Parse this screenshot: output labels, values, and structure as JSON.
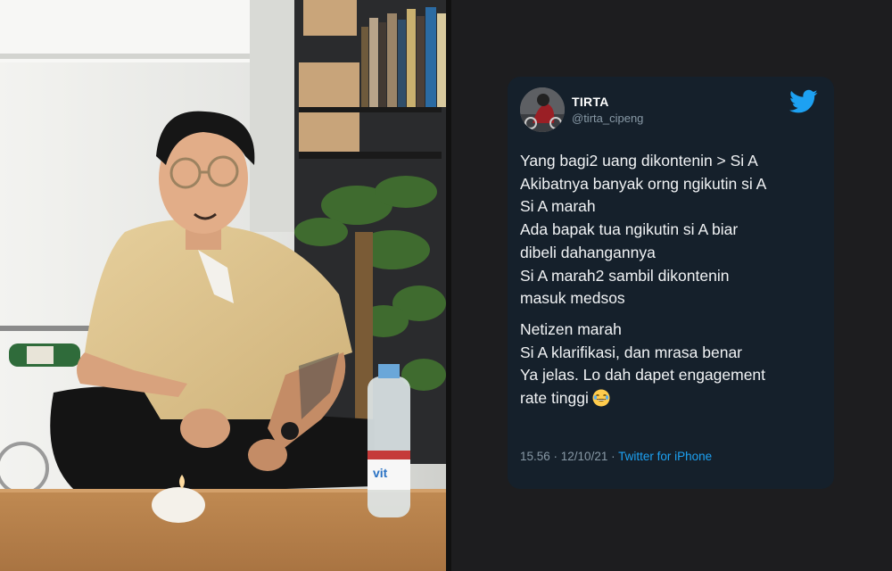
{
  "tweet": {
    "author_name": "TIRTA",
    "author_handle": "@tirta_cipeng",
    "paragraphs": [
      [
        "Yang bagi2 uang dikontenin > Si A",
        "Akibatnya banyak orng ngikutin si A",
        "Si A marah",
        "Ada bapak tua ngikutin si A biar",
        "dibeli dahangannya",
        "Si A marah2 sambil dikontenin",
        "masuk medsos"
      ],
      [
        "Netizen marah",
        "Si A klarifikasi, dan mrasa benar",
        "Ya jelas. Lo dah dapet engagement",
        "rate tinggi"
      ]
    ],
    "emoji": "face-with-tears-of-joy",
    "timestamp": "15.56 · 12/10/21 · ",
    "source": "Twitter for iPhone"
  },
  "photo": {
    "bottle_label": "vit"
  },
  "colors": {
    "card_bg": "#15202b",
    "link_blue": "#1da1f2",
    "muted_text": "#8899a6",
    "panel_bg": "#1d1d1f"
  },
  "icons": {
    "brand": "twitter-bird-icon",
    "avatar": "avatar-photo"
  }
}
